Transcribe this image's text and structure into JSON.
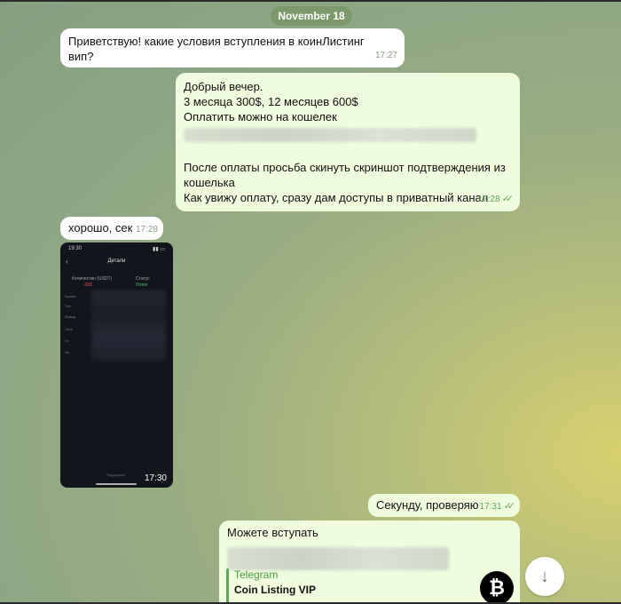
{
  "date_separator": "November 18",
  "messages": [
    {
      "direction": "in",
      "text": "Приветствую! какие условия вступления в коинЛистинг вип?",
      "time": "17:27"
    },
    {
      "direction": "out",
      "lines": [
        "Добрый вечер.",
        "3 месяца 300$, 12 месяцев 600$",
        "Оплатить можно на кошелек",
        "После оплаты просьба скинуть скриншот подтверждения из кошелька",
        "Как увижу оплату, сразу дам доступы в приватный канал"
      ],
      "time": "17:28",
      "read": true
    },
    {
      "direction": "in",
      "text": "хорошо, сек",
      "time": "17:28"
    },
    {
      "direction": "in",
      "type": "photo",
      "time": "17:30",
      "photo": {
        "status_time": "19:30",
        "screen_title": "Детали",
        "amount_label": "Количество (USDT)",
        "amount_value": "-300",
        "status_label": "Статус",
        "status_value": "Успех",
        "row_labels": [
          "Время",
          "Тип",
          "Вывод",
          "Сеть",
          "От",
          "На"
        ],
        "footer_text": "Поддержка"
      }
    },
    {
      "direction": "out",
      "text": "Секунду, проверяю",
      "time": "17:31",
      "read": true
    },
    {
      "direction": "out",
      "text": "Можете вступать",
      "preview": {
        "site": "Telegram",
        "title": "Coin Listing VIP",
        "icon": "bitcoin-icon"
      }
    }
  ],
  "scroll_button": {
    "icon": "arrow-down-icon",
    "glyph": "↓"
  }
}
